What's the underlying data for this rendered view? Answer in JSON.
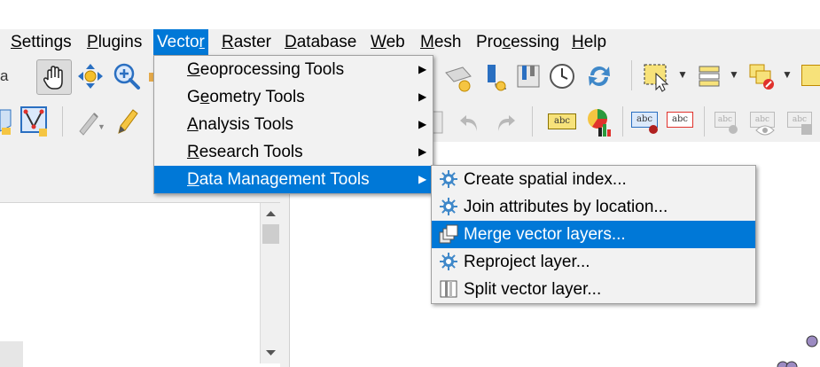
{
  "menubar": {
    "items": [
      {
        "label": "Settings",
        "mn": "S",
        "rest": "ettings"
      },
      {
        "label": "Plugins",
        "mn": "P",
        "rest": "lugins"
      },
      {
        "label": "Vector",
        "pre": "Vecto",
        "mn": "r",
        "rest": ""
      },
      {
        "label": "Raster",
        "mn": "R",
        "rest": "aster"
      },
      {
        "label": "Database",
        "mn": "D",
        "rest": "atabase"
      },
      {
        "label": "Web",
        "mn": "W",
        "rest": "eb"
      },
      {
        "label": "Mesh",
        "mn": "M",
        "rest": "esh"
      },
      {
        "label": "Processing",
        "pre": "Pro",
        "mn": "c",
        "rest": "essing"
      },
      {
        "label": "Help",
        "mn": "H",
        "rest": "elp"
      }
    ]
  },
  "vector_menu": {
    "items": [
      {
        "label": "Geoprocessing Tools",
        "mn": "G",
        "rest": "eoprocessing Tools"
      },
      {
        "label": "Geometry Tools",
        "pre": "G",
        "mn": "e",
        "rest": "ometry Tools"
      },
      {
        "label": "Analysis Tools",
        "mn": "A",
        "rest": "nalysis Tools"
      },
      {
        "label": "Research Tools",
        "mn": "R",
        "rest": "esearch Tools"
      },
      {
        "label": "Data Management Tools",
        "mn": "D",
        "rest": "ata Management Tools"
      }
    ]
  },
  "data_management_submenu": {
    "items": [
      {
        "label": "Create spatial index...",
        "icon": "gear-icon"
      },
      {
        "label": "Join attributes by location...",
        "icon": "gear-icon"
      },
      {
        "label": "Merge vector layers...",
        "icon": "merge-layers-icon"
      },
      {
        "label": "Reproject layer...",
        "icon": "gear-icon"
      },
      {
        "label": "Split vector layer...",
        "icon": "split-layer-icon"
      }
    ]
  },
  "toolbar": {
    "label_abc": "abc",
    "partial_label": "a"
  },
  "colors": {
    "accent": "#0078d7",
    "menu_bg": "#f2f2f2",
    "toolbar_bg": "#f0f0f0",
    "gear_blue": "#3f88c9"
  }
}
